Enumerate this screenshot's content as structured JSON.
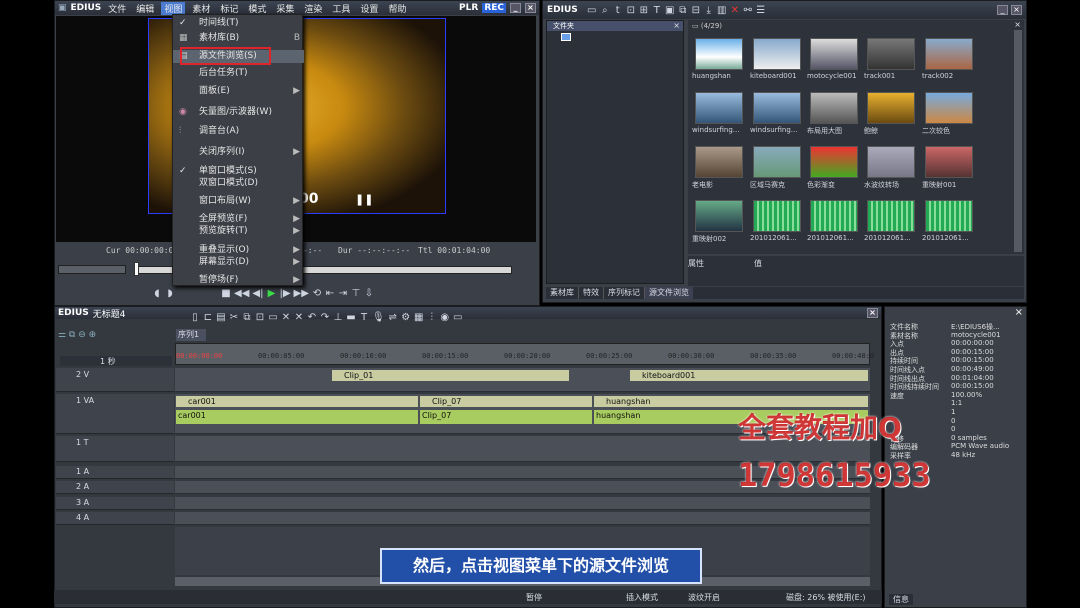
{
  "player": {
    "app": "EDIUS",
    "menus": [
      "文件",
      "编辑",
      "视图",
      "素材",
      "标记",
      "模式",
      "采集",
      "渲染",
      "工具",
      "设置",
      "帮助"
    ],
    "plr": "PLR",
    "rec": "REC",
    "cur": "Cur 00:00:00:00",
    "in": "In --:--:--:--",
    "out": "Out --:--:--:--",
    "dur": "Dur --:--:--:--",
    "ttl": "Ttl 00:01:04:00",
    "screen_text": "00"
  },
  "view_menu": [
    {
      "label": "时间线(T)",
      "check": "✓",
      "shortcut": "",
      "arrow": ""
    },
    {
      "label": "素材库(B)",
      "check": "",
      "shortcut": "B",
      "arrow": ""
    },
    {
      "label": "源文件浏览(S)",
      "check": "",
      "shortcut": "",
      "arrow": ""
    },
    {
      "label": "后台任务(T)",
      "check": "",
      "shortcut": "",
      "arrow": ""
    },
    {
      "label": "面板(E)",
      "check": "",
      "shortcut": "",
      "arrow": "▶"
    },
    {
      "label": "矢量图/示波器(W)",
      "check": "",
      "shortcut": "",
      "arrow": ""
    },
    {
      "label": "调音台(A)",
      "check": "",
      "shortcut": "",
      "arrow": ""
    },
    {
      "label": "关闭序列(I)",
      "check": "",
      "shortcut": "",
      "arrow": "▶"
    },
    {
      "label": "单窗口模式(S)",
      "check": "✓",
      "shortcut": "",
      "arrow": ""
    },
    {
      "label": "双窗口模式(D)",
      "check": "",
      "shortcut": "",
      "arrow": ""
    },
    {
      "label": "窗口布局(W)",
      "check": "",
      "shortcut": "",
      "arrow": "▶"
    },
    {
      "label": "全屏预览(F)",
      "check": "",
      "shortcut": "",
      "arrow": "▶"
    },
    {
      "label": "预览旋转(T)",
      "check": "",
      "shortcut": "",
      "arrow": "▶"
    },
    {
      "label": "重叠显示(O)",
      "check": "",
      "shortcut": "",
      "arrow": "▶"
    },
    {
      "label": "屏幕显示(D)",
      "check": "",
      "shortcut": "",
      "arrow": "▶"
    },
    {
      "label": "暂停场(F)",
      "check": "",
      "shortcut": "",
      "arrow": "▶"
    }
  ],
  "bin": {
    "app": "EDIUS",
    "folder_header": "文件夹",
    "count": "(4/29)",
    "tabs": [
      "素材库",
      "特效",
      "序列标记",
      "源文件浏览"
    ],
    "prop_header": "属性",
    "value_header": "值",
    "clips": [
      "huangshan",
      "kiteboard001",
      "motocycle001",
      "track001",
      "track002",
      "windsurfing...",
      "windsurfing...",
      "布局用大图",
      "鲍鲸",
      "二次较色",
      "老电影",
      "区域马赛克",
      "色彩渐变",
      "水波纹转场",
      "重映射001",
      "重映射002",
      "201012061...",
      "201012061...",
      "201012061...",
      "201012061..."
    ]
  },
  "timeline": {
    "app": "EDIUS",
    "project": "无标题4",
    "seq_tab": "序列1",
    "ruler": [
      "00:00:00:00",
      "00:00:05:00",
      "00:00:10:00",
      "00:00:15:00",
      "00:00:20:00",
      "00:00:25:00",
      "00:00:30:00",
      "00:00:35:00",
      "00:00:40:0"
    ],
    "zoom": "1 秒",
    "tracks": [
      "2 V",
      "1 VA",
      "1 T",
      "1 A",
      "2 A",
      "3 A",
      "4 A"
    ],
    "clips_v2": [
      {
        "name": "Clip_01"
      },
      {
        "name": "kiteboard001"
      }
    ],
    "clips_va": [
      {
        "name": "car001"
      },
      {
        "name": "Clip_07"
      },
      {
        "name": "huangshan"
      }
    ],
    "clips_a": [
      {
        "name": "car001"
      },
      {
        "name": "Clip_07"
      },
      {
        "name": "huangshan"
      }
    ]
  },
  "info": {
    "rows": [
      [
        "文件名称",
        "E:\\EDIUS6操..."
      ],
      [
        "素材名称",
        "motocycle001"
      ],
      [
        "入点",
        "00:00:00:00"
      ],
      [
        "出点",
        "00:00:15:00"
      ],
      [
        "持续时间",
        "00:00:15:00"
      ],
      [
        "时间线入点",
        "00:00:49:00"
      ],
      [
        "时间线出点",
        "00:01:04:00"
      ],
      [
        "时间线持续时间",
        "00:00:15:00"
      ],
      [
        "速度",
        "100.00%"
      ],
      [
        "",
        "1:1"
      ],
      [
        "",
        "1"
      ],
      [
        "",
        "0"
      ],
      [
        "",
        "0"
      ],
      [
        "偏移",
        "0 samples"
      ],
      [
        "编解码器",
        "PCM Wave audio"
      ],
      [
        "采样率",
        "48 kHz"
      ]
    ],
    "tab": "信息"
  },
  "status": {
    "items": [
      "暂停",
      "插入模式",
      "波纹开启",
      "磁盘: 26% 被使用(E:)"
    ]
  },
  "subtitle": "然后，点击视图菜单下的源文件浏览",
  "watermark": {
    "line1": "全套教程加Q",
    "line2": "1798615933"
  }
}
